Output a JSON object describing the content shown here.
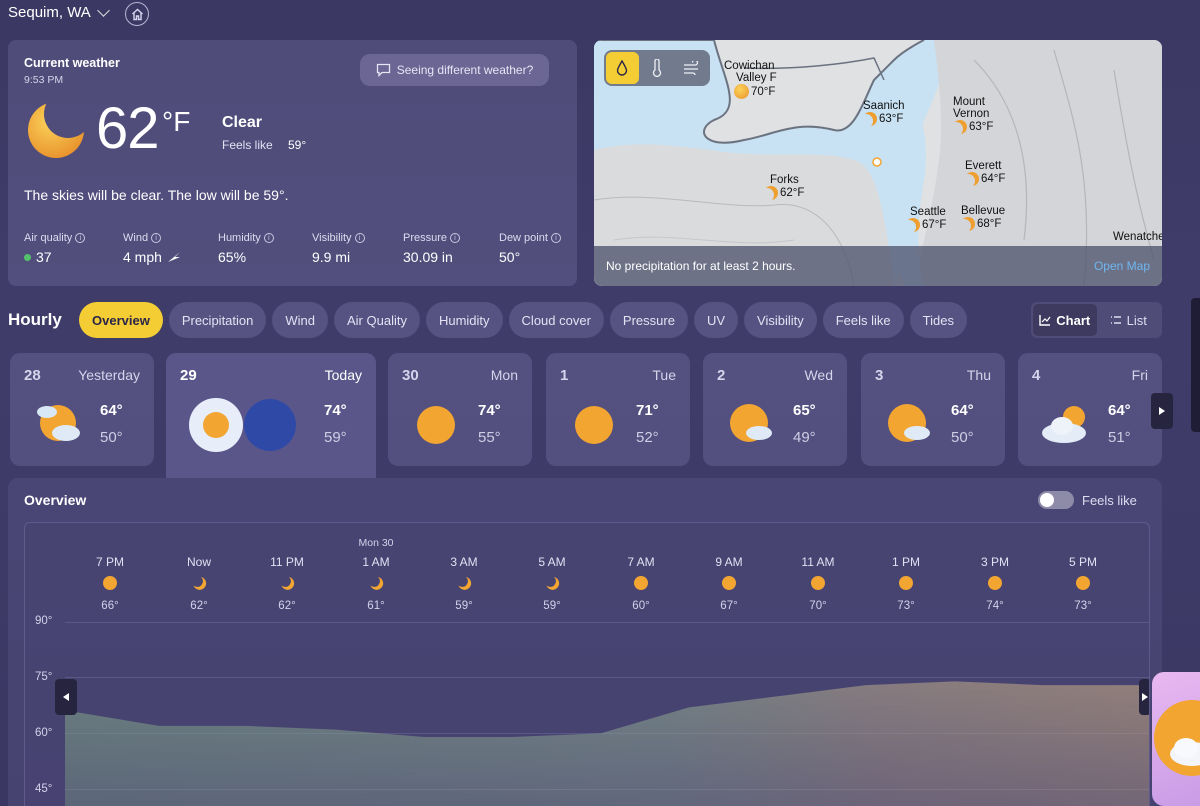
{
  "header": {
    "location": "Sequim, WA"
  },
  "current": {
    "title": "Current weather",
    "time": "9:53 PM",
    "different_btn": "Seeing different weather?",
    "temp": "62",
    "unit": "°F",
    "condition": "Clear",
    "feels_label": "Feels like",
    "feels_value": "59°",
    "summary": "The skies will be clear. The low will be 59°.",
    "metrics": [
      {
        "label": "Air quality",
        "value": "37"
      },
      {
        "label": "Wind",
        "value": "4 mph"
      },
      {
        "label": "Humidity",
        "value": "65%"
      },
      {
        "label": "Visibility",
        "value": "9.9 mi"
      },
      {
        "label": "Pressure",
        "value": "30.09 in"
      },
      {
        "label": "Dew point",
        "value": "50°"
      }
    ]
  },
  "map": {
    "footer_text": "No precipitation for at least 2 hours.",
    "open_map": "Open Map",
    "cities": [
      {
        "name": "Cowichan Valley F",
        "line1": "Cowichan",
        "line2": "Valley F",
        "temp": "70°F"
      },
      {
        "name": "Saanich",
        "line1": "Saanich",
        "line2": "",
        "temp": "63°F"
      },
      {
        "name": "Mount Vernon",
        "line1": "Mount",
        "line2": "Vernon",
        "temp": "63°F"
      },
      {
        "name": "Everett",
        "line1": "Everett",
        "line2": "",
        "temp": "64°F"
      },
      {
        "name": "Forks",
        "line1": "Forks",
        "line2": "",
        "temp": "62°F"
      },
      {
        "name": "Seattle",
        "line1": "Seattle",
        "line2": "",
        "temp": "67°F"
      },
      {
        "name": "Bellevue",
        "line1": "Bellevue",
        "line2": "",
        "temp": "68°F"
      },
      {
        "name": "Wenatche",
        "line1": "Wenatche",
        "line2": "",
        "temp": ""
      }
    ]
  },
  "hourly": {
    "title": "Hourly",
    "tabs": [
      "Overview",
      "Precipitation",
      "Wind",
      "Air Quality",
      "Humidity",
      "Cloud cover",
      "Pressure",
      "UV",
      "Visibility",
      "Feels like",
      "Tides"
    ],
    "active_tab": "Overview",
    "view_chart": "Chart",
    "view_list": "List"
  },
  "days": [
    {
      "num": "28",
      "name": "Yesterday",
      "hi": "64°",
      "lo": "50°",
      "icon": "partly-cloudy-icon"
    },
    {
      "num": "29",
      "name": "Today",
      "hi": "74°",
      "lo": "59°",
      "icon": "sun-moon-icon"
    },
    {
      "num": "30",
      "name": "Mon",
      "hi": "74°",
      "lo": "55°",
      "icon": "sun-icon"
    },
    {
      "num": "1",
      "name": "Tue",
      "hi": "71°",
      "lo": "52°",
      "icon": "sun-icon"
    },
    {
      "num": "2",
      "name": "Wed",
      "hi": "65°",
      "lo": "49°",
      "icon": "partly-cloudy-icon"
    },
    {
      "num": "3",
      "name": "Thu",
      "hi": "64°",
      "lo": "50°",
      "icon": "partly-cloudy-icon"
    },
    {
      "num": "4",
      "name": "Fri",
      "hi": "64°",
      "lo": "51°",
      "icon": "cloudy-icon"
    }
  ],
  "overview": {
    "title": "Overview",
    "feels_like_toggle": "Feels like",
    "date_marker": "Mon 30",
    "hours": [
      {
        "time": "7 PM",
        "temp": "66°",
        "icon": "sun-icon"
      },
      {
        "time": "Now",
        "temp": "62°",
        "icon": "moon-icon"
      },
      {
        "time": "11 PM",
        "temp": "62°",
        "icon": "moon-icon"
      },
      {
        "time": "1 AM",
        "temp": "61°",
        "icon": "moon-icon"
      },
      {
        "time": "3 AM",
        "temp": "59°",
        "icon": "moon-icon"
      },
      {
        "time": "5 AM",
        "temp": "59°",
        "icon": "moon-icon"
      },
      {
        "time": "7 AM",
        "temp": "60°",
        "icon": "sun-icon"
      },
      {
        "time": "9 AM",
        "temp": "67°",
        "icon": "sun-icon"
      },
      {
        "time": "11 AM",
        "temp": "70°",
        "icon": "sun-icon"
      },
      {
        "time": "1 PM",
        "temp": "73°",
        "icon": "sun-icon"
      },
      {
        "time": "3 PM",
        "temp": "74°",
        "icon": "sun-icon"
      },
      {
        "time": "5 PM",
        "temp": "73°",
        "icon": "sun-icon"
      }
    ],
    "y_labels": [
      "90°",
      "75°",
      "60°",
      "45°"
    ]
  },
  "colors": {
    "accent_yellow": "#f4cd34",
    "sun_orange": "#f2a531",
    "aq_good": "#53c26b",
    "map_link": "#6fb6f0"
  }
}
